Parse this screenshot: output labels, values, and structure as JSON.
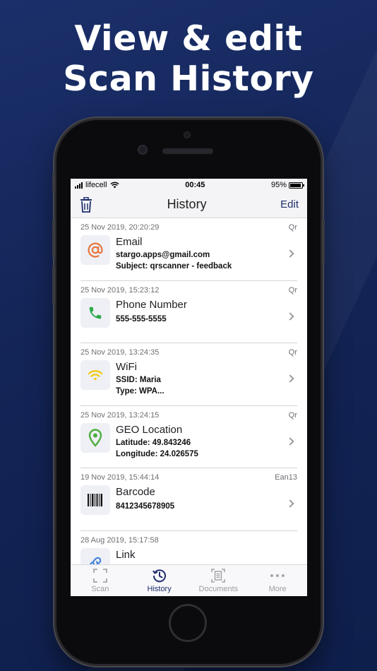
{
  "promo": {
    "headline_line1": "View & edit",
    "headline_line2": "Scan History"
  },
  "status_bar": {
    "carrier": "lifecell",
    "time": "00:45",
    "battery": "95%"
  },
  "nav": {
    "title": "History",
    "edit_label": "Edit",
    "delete_icon": "trash-icon"
  },
  "history": [
    {
      "date": "25 Nov 2019, 20:20:29",
      "format": "Qr",
      "title": "Email",
      "lines": [
        "stargo.apps@gmail.com",
        "Subject: qrscanner - feedback"
      ],
      "icon": "email-at-icon"
    },
    {
      "date": "25 Nov 2019, 15:23:12",
      "format": "Qr",
      "title": "Phone Number",
      "lines": [
        "555-555-5555",
        ""
      ],
      "icon": "phone-icon"
    },
    {
      "date": "25 Nov 2019, 13:24:35",
      "format": "Qr",
      "title": "WiFi",
      "lines": [
        "SSID: Maria",
        "Type: WPA..."
      ],
      "icon": "wifi-icon"
    },
    {
      "date": "25 Nov 2019, 13:24:15",
      "format": "Qr",
      "title": "GEO Location",
      "lines": [
        "Latitude: 49.843246",
        "Longitude: 24.026575"
      ],
      "icon": "location-pin-icon"
    },
    {
      "date": "19 Nov 2019, 15:44:14",
      "format": "Ean13",
      "title": "Barcode",
      "lines": [
        "8412345678905",
        ""
      ],
      "icon": "barcode-icon"
    },
    {
      "date": "28 Aug 2019, 15:17:58",
      "format": "",
      "title": "Link",
      "lines": [
        "",
        ""
      ],
      "icon": "link-icon"
    }
  ],
  "tabs": [
    {
      "label": "Scan",
      "icon": "scan-frame-icon",
      "active": false
    },
    {
      "label": "History",
      "icon": "history-clock-icon",
      "active": true
    },
    {
      "label": "Documents",
      "icon": "documents-icon",
      "active": false
    },
    {
      "label": "More",
      "icon": "more-dots-icon",
      "active": false
    }
  ],
  "colors": {
    "background": "#16275a",
    "accent": "#1e2d6a",
    "email_icon": "#e8743b",
    "phone_icon": "#2faa4a",
    "wifi_icon": "#f2c800",
    "location_icon": "#4cae3c",
    "link_icon": "#3b7bd8"
  }
}
